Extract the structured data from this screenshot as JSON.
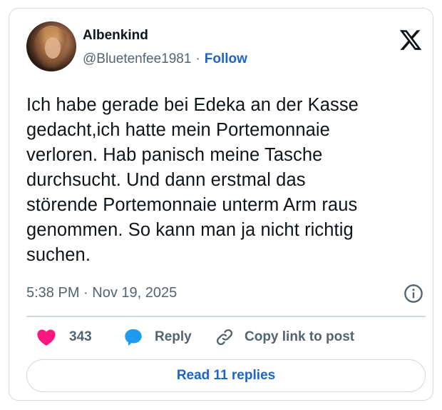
{
  "author": {
    "name": "Albenkind",
    "handle": "@Bluetenfee1981",
    "separator": "·",
    "follow_label": "Follow"
  },
  "tweet": {
    "text": "Ich habe gerade bei Edeka an der Kasse\ngedacht,ich hatte mein Portemonnaie\nverloren. Hab panisch meine Tasche\ndurchsucht. Und dann erstmal das\nstörende Portemonnaie unterm Arm raus\ngenommen. So kann man ja nicht richtig\nsuchen.",
    "timestamp": "5:38 PM · Nov 19, 2025"
  },
  "actions": {
    "like_count": "343",
    "reply_label": "Reply",
    "copy_label": "Copy link to post"
  },
  "read_replies_label": "Read 11 replies",
  "icons": {
    "brand": "x-logo-icon",
    "info": "info-icon",
    "like": "heart-icon",
    "reply": "speech-bubble-icon",
    "copy": "link-icon"
  },
  "colors": {
    "heart": "#f91880",
    "reply_bubble": "#1d9bf0",
    "link_blue": "#1d64c8",
    "muted": "#536471",
    "border": "#cfd9de"
  }
}
